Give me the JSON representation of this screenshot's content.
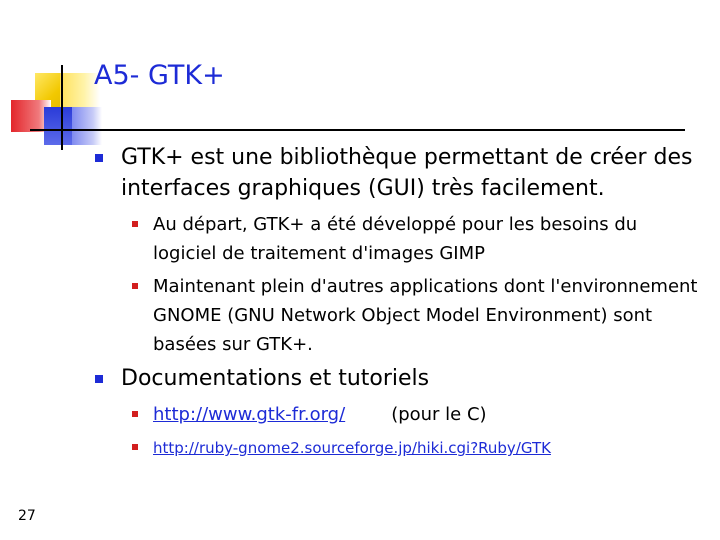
{
  "slide": {
    "title": "A5- GTK+",
    "page_number": "27"
  },
  "bullets": {
    "main1": "GTK+ est une bibliothèque permettant de créer des interfaces graphiques (GUI) très facilement.",
    "sub1": "Au départ, GTK+ a été développé pour les besoins du logiciel de traitement d'images GIMP",
    "sub2": "Maintenant plein d'autres applications dont l'environnement GNOME (GNU Network Object Model Environment) sont basées sur GTK+.",
    "main2": "Documentations et tutoriels",
    "link1": "http://www.gtk-fr.org/",
    "link1_note": "(pour le C)",
    "link2": "http://ruby-gnome2.sourceforge.jp/hiki.cgi?Ruby/GTK"
  },
  "colors": {
    "title": "#1d2bd6",
    "level1_bullet": "#1d2bd6",
    "level2_bullet": "#d21e1e",
    "link": "#1d2bd6"
  }
}
